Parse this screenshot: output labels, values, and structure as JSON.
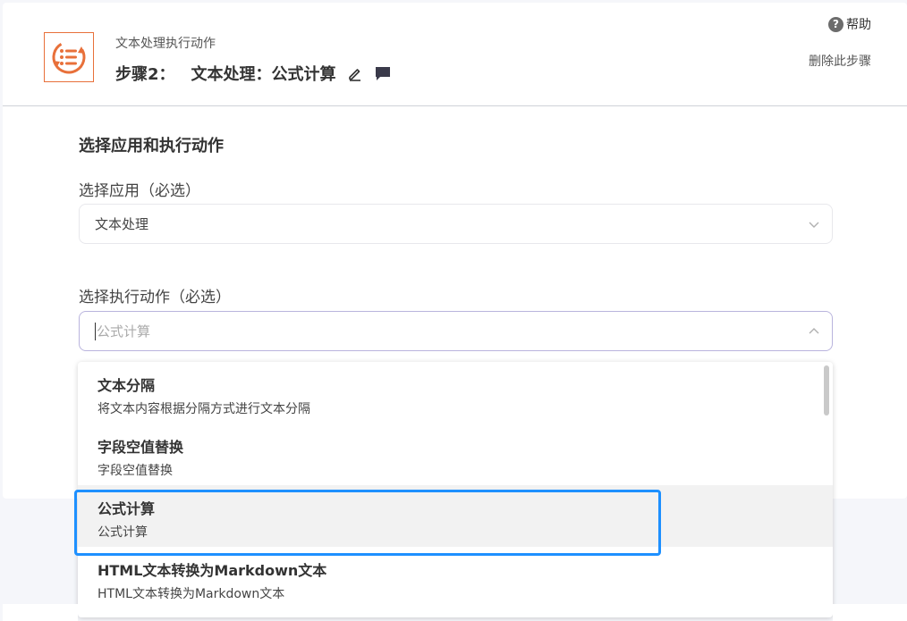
{
  "header": {
    "subtitle": "文本处理执行动作",
    "step_label": "步骤2：",
    "step_title": "文本处理：公式计算",
    "help_label": "帮助",
    "help_badge": "?",
    "delete_label": "删除此步骤"
  },
  "section": {
    "title": "选择应用和执行动作"
  },
  "app_select": {
    "label": "选择应用（必选）",
    "value": "文本处理"
  },
  "action_select": {
    "label": "选择执行动作（必选）",
    "placeholder": "公式计算"
  },
  "dropdown": {
    "options": [
      {
        "title": "文本分隔",
        "desc": "将文本内容根据分隔方式进行文本分隔"
      },
      {
        "title": "字段空值替换",
        "desc": "字段空值替换"
      },
      {
        "title": "公式计算",
        "desc": "公式计算"
      },
      {
        "title": "HTML文本转换为Markdown文本",
        "desc": "HTML文本转换为Markdown文本"
      }
    ],
    "active_index": 2
  },
  "colors": {
    "accent": "#e8703a",
    "highlight": "#1e90ff",
    "focus_border": "#b9b4dd"
  }
}
